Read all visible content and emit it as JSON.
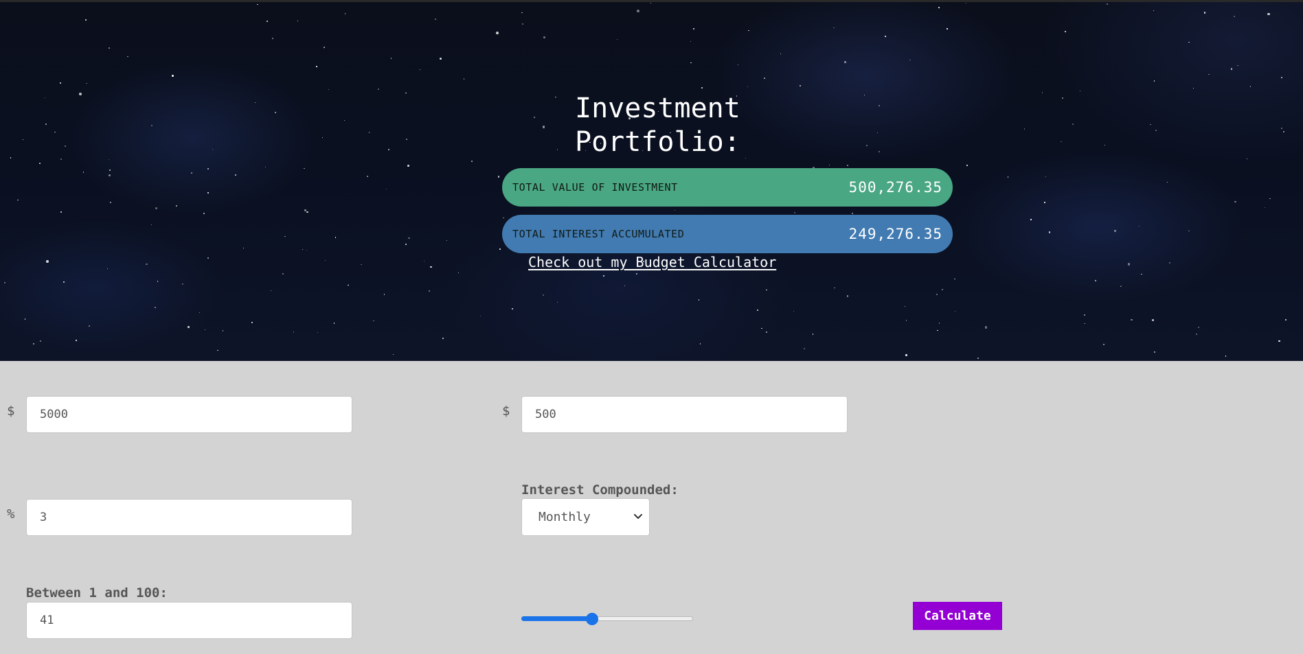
{
  "header": {
    "title": "Investment Portfolio:",
    "total_value_label": "TOTAL VALUE OF INVESTMENT",
    "total_value": "500,276.35",
    "total_interest_label": "TOTAL INTEREST ACCUMULATED",
    "total_interest": "249,276.35",
    "budget_link": "Check out my Budget Calculator"
  },
  "form": {
    "initial_prefix": "$",
    "initial_value": "5000",
    "contribution_prefix": "$",
    "contribution_value": "500",
    "rate_prefix": "%",
    "rate_value": "3",
    "compound_label": "Interest Compounded:",
    "compound_selected": "Monthly",
    "years_label": "Between 1 and 100:",
    "years_value": "41",
    "slider_fraction": 0.41,
    "calculate_label": "Calculate"
  },
  "colors": {
    "value_pill": "#4aa784",
    "interest_pill": "#427bb2",
    "calculate_button": "#9400d3",
    "slider_accent": "#1a73e8"
  }
}
